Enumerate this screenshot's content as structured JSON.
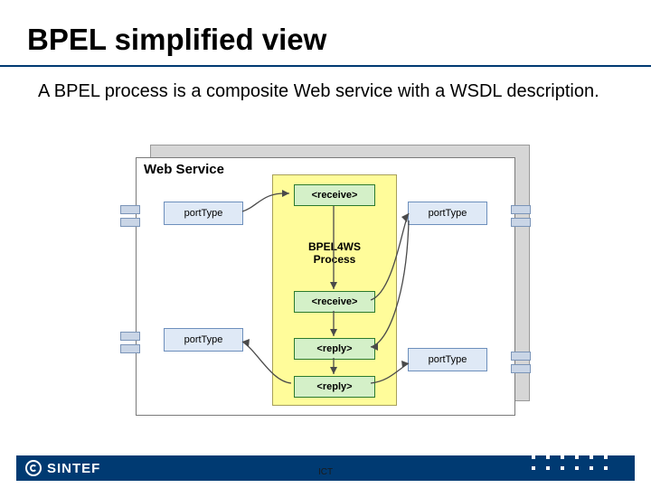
{
  "title": "BPEL simplified view",
  "body": "A BPEL process is a composite Web service with a WSDL description.",
  "diagram": {
    "container_label": "Web Service",
    "process_label_line1": "BPEL4WS",
    "process_label_line2": "Process",
    "activities": [
      "<receive>",
      "<receive>",
      "<reply>",
      "<reply>"
    ],
    "port_type_label": "portType"
  },
  "footer": {
    "logo_text": "SINTEF",
    "center_label": "ICT"
  },
  "colors": {
    "brand_blue": "#003a72",
    "bpel_yellow": "#fffc9a",
    "activity_green": "#d4f0c8",
    "port_blue": "#dfe9f6"
  }
}
